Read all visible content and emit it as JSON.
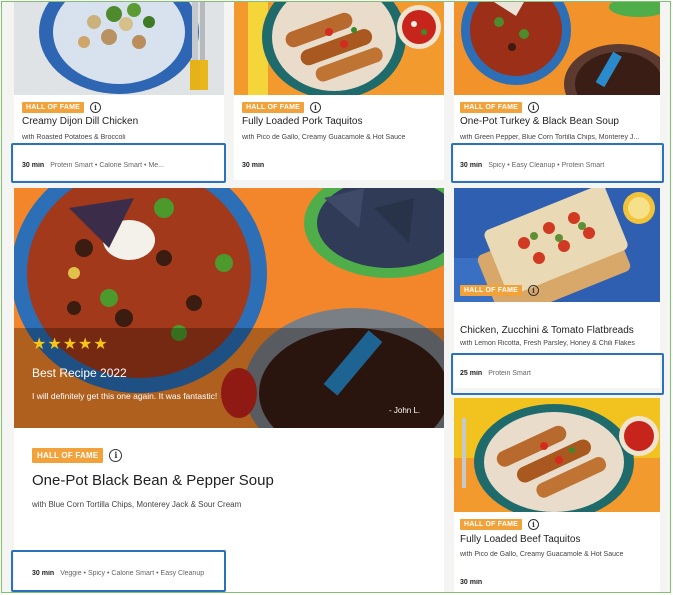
{
  "badge_label": "HALL OF FAME",
  "info_glyph": "i",
  "cards": [
    {
      "title": "Creamy Dijon Dill Chicken",
      "subtitle": "with Roasted Potatoes & Broccoli",
      "time": "30 min",
      "tags": "Protein Smart • Calorie Smart • Me..."
    },
    {
      "title": "Fully Loaded Pork Taquitos",
      "subtitle": "with Pico de Gallo, Creamy Guacamole & Hot Sauce",
      "time": "30 min",
      "tags": ""
    },
    {
      "title": "One-Pot Turkey & Black Bean Soup",
      "subtitle": "with Green Pepper, Blue Corn Tortilla Chips, Monterey J...",
      "time": "30 min",
      "tags": "Spicy • Easy Cleanup • Protein Smart"
    },
    {
      "title": "Chicken, Zucchini & Tomato Flatbreads",
      "subtitle": "with Lemon Ricotta, Fresh Parsley, Honey & Chili Flakes",
      "time": "25 min",
      "tags": "Protein Smart"
    },
    {
      "title": "Fully Loaded Beef Taquitos",
      "subtitle": "with Pico de Gallo, Creamy Guacamole & Hot Sauce",
      "time": "30 min",
      "tags": ""
    }
  ],
  "featured": {
    "stars": "★★★★★",
    "award": "Best Recipe 2022",
    "quote": "I will definitely get this one again. It was fantastic!",
    "author": "- John L.",
    "title": "One-Pot Black Bean & Pepper Soup",
    "subtitle": "with Blue Corn Tortilla Chips, Monterey Jack & Sour Cream",
    "time": "30 min",
    "tags": "Veggie • Spicy • Calorie Smart • Easy Cleanup"
  },
  "colors": {
    "badge": "#f2a23a",
    "highlight": "#2b72b9",
    "frame": "#7cc36a",
    "star": "#f5c518"
  }
}
